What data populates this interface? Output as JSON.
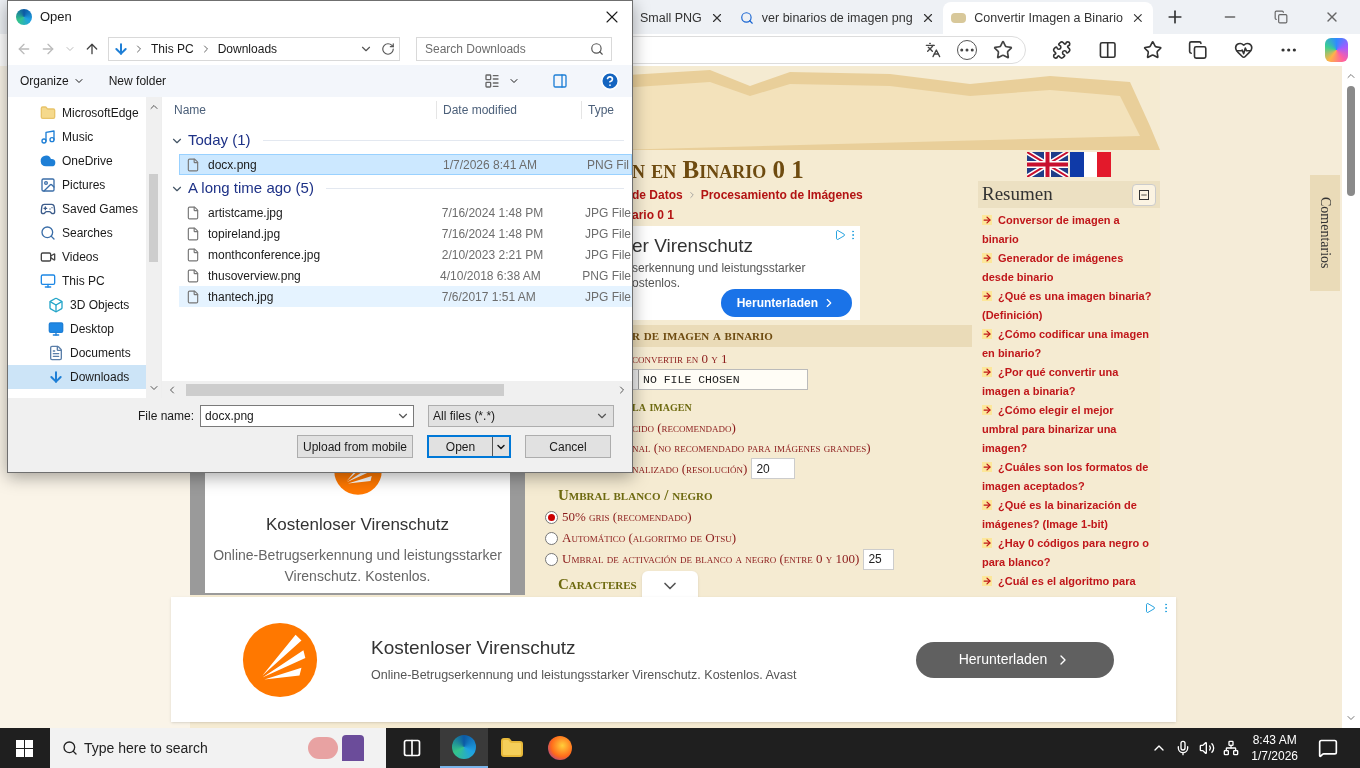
{
  "browser": {
    "tabs": [
      {
        "title": "Small PNG",
        "selected": false
      },
      {
        "title": "ver binarios de imagen png",
        "selected": false
      },
      {
        "title": "Convertir Imagen a Binario",
        "selected": true
      }
    ]
  },
  "page": {
    "heading": "n en Binario 0 1",
    "breadcrumb": [
      "de Datos",
      "Procesamiento de Imágenes"
    ],
    "subtitle": "ario 0 1",
    "inline_ad": {
      "title": "er Virenschutz",
      "lines": [
        "serkennung und leistungsstarker",
        "ostenlos."
      ],
      "button": "Herunterladen"
    },
    "section_title": "r de imagen a binario",
    "upload_label": "convertir en 0 y 1",
    "file_status": "NO FILE CHOSEN",
    "size_heading": "la imagen",
    "size_options": [
      {
        "label": "cido (recomendado)",
        "kind": "plain"
      },
      {
        "label": "nal (no recomendado para imágenes grandes)",
        "kind": "plain"
      },
      {
        "label": "nalizado (resolución)",
        "kind": "number",
        "value": "20"
      }
    ],
    "threshold_heading": "Umbral blanco / negro",
    "threshold_options": [
      {
        "label": "50% gris (recomendado)",
        "selected": true
      },
      {
        "label": "Automático (algoritmo de Otsu)",
        "selected": false
      },
      {
        "label": "Umbral de activación de blanco a negro (entre 0 y 100)",
        "selected": false,
        "value": "25"
      }
    ],
    "chars_heading": "Caracteres",
    "side_ad": {
      "title": "Kostenloser Virenschutz",
      "text": "Online-Betrugserkennung und leistungsstarker Virenschutz. Kostenlos."
    },
    "summary": {
      "title": "Resumen",
      "items": [
        "Conversor de imagen a binario",
        "Generador de imágenes desde binario",
        "¿Qué es una imagen binaria? (Definición)",
        "¿Cómo codificar una imagen en binario?",
        "¿Por qué convertir una imagen a binaria?",
        "¿Cómo elegir el mejor umbral para binarizar una imagen?",
        "¿Cuáles son los formatos de imagen aceptados?",
        "¿Qué es la binarización de imágenes? (Image 1-bit)",
        "¿Hay 0 códigos para negro o para blanco?",
        "¿Cuál es el algoritmo para"
      ]
    },
    "comments_tab": "Comentarios",
    "banner_ad": {
      "title": "Kostenloser Virenschutz",
      "text": "Online-Betrugserkennung und leistungsstarker Virenschutz. Kostenlos. Avast",
      "button": "Herunterladen"
    }
  },
  "dialog": {
    "title": "Open",
    "path": [
      "This PC",
      "Downloads"
    ],
    "search": {
      "placeholder": "Search Downloads"
    },
    "toolbar": [
      "Organize",
      "New folder"
    ],
    "nav": [
      {
        "label": "MicrosoftEdge",
        "kind": "folder",
        "selected": false
      },
      {
        "label": "Music",
        "kind": "music",
        "selected": false
      },
      {
        "label": "OneDrive",
        "kind": "cloud",
        "selected": false
      },
      {
        "label": "Pictures",
        "kind": "image",
        "selected": false
      },
      {
        "label": "Saved Games",
        "kind": "game",
        "selected": false
      },
      {
        "label": "Searches",
        "kind": "search",
        "selected": false
      },
      {
        "label": "Videos",
        "kind": "video",
        "selected": false
      },
      {
        "label": "This PC",
        "kind": "pc",
        "selected": false,
        "children": [
          {
            "label": "3D Objects",
            "kind": "cube",
            "selected": false
          },
          {
            "label": "Desktop",
            "kind": "desktop",
            "selected": false
          },
          {
            "label": "Documents",
            "kind": "doc",
            "selected": false
          },
          {
            "label": "Downloads",
            "kind": "download",
            "selected": true
          }
        ]
      }
    ],
    "columns": [
      "Name",
      "Date modified",
      "Type"
    ],
    "groups": [
      {
        "title": "Today (1)",
        "files": [
          {
            "name": "docx.png",
            "date": "1/7/2026 8:41 AM",
            "type": "PNG Fil",
            "selected": true,
            "hovered": false
          }
        ]
      },
      {
        "title": "A long time ago (5)",
        "files": [
          {
            "name": "artistcame.jpg",
            "date": "7/16/2024 1:48 PM",
            "type": "JPG File",
            "selected": false,
            "hovered": false
          },
          {
            "name": "topireland.jpg",
            "date": "7/16/2024 1:48 PM",
            "type": "JPG File",
            "selected": false,
            "hovered": false
          },
          {
            "name": "monthconference.jpg",
            "date": "2/10/2023 2:21 PM",
            "type": "JPG File",
            "selected": false,
            "hovered": false
          },
          {
            "name": "thusoverview.png",
            "date": "4/10/2018 6:38 AM",
            "type": "PNG File",
            "selected": false,
            "hovered": false
          },
          {
            "name": "thantech.jpg",
            "date": "7/6/2017 1:51 AM",
            "type": "JPG File",
            "selected": false,
            "hovered": true
          }
        ]
      }
    ],
    "file_name_label": "File name:",
    "file_name": "docx.png",
    "filter": "All files (*.*)",
    "buttons": [
      "Upload from mobile",
      "Open",
      "Cancel"
    ]
  },
  "taskbar": {
    "search_placeholder": "Type here to search",
    "time": "8:43 AM",
    "date": "1/7/2026"
  }
}
